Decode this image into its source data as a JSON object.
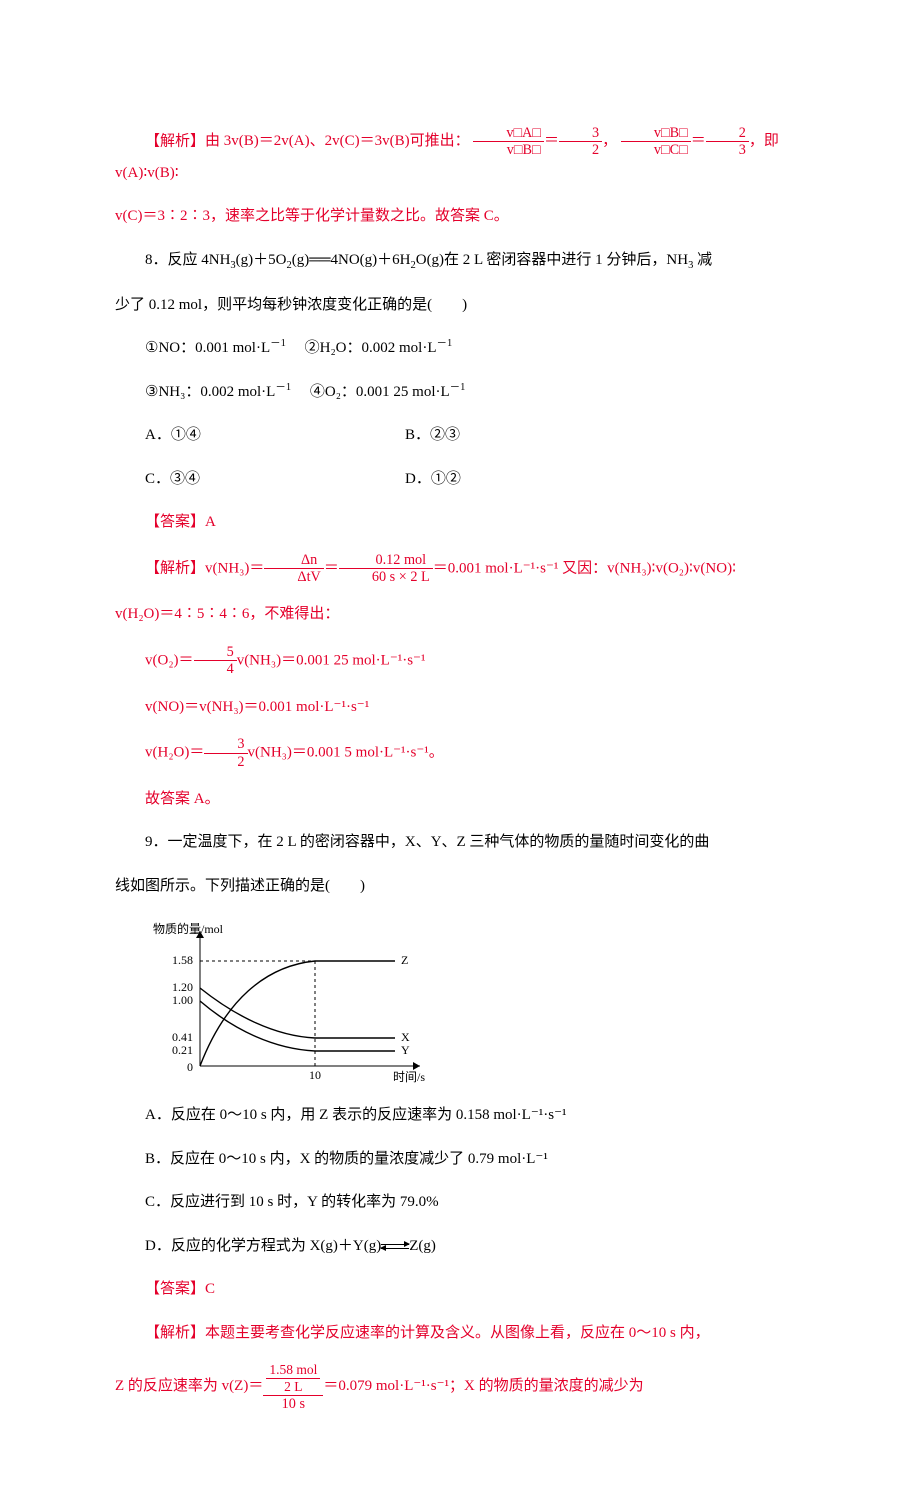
{
  "q7": {
    "analysis_prefix": "【解析】",
    "analysis_body1": "由 3v(B)＝2v(A)、2v(C)＝3v(B)可推出：",
    "frac1_num": "v□A□",
    "frac1_den": "v□B□",
    "frac1_eq": "＝",
    "frac1b_num": "3",
    "frac1b_den": "2",
    "sep1": "，",
    "frac2_num": "v□B□",
    "frac2_den": "v□C□",
    "frac2_eq": "＝",
    "frac2b_num": "2",
    "frac2b_den": "3",
    "tail1": "，即 v(A)∶v(B)∶",
    "line2": "v(C)＝3∶2∶3，速率之比等于化学计量数之比。故答案 C。"
  },
  "q8": {
    "stem_a": "8．反应 4NH",
    "stem_a_sub": "3",
    "stem_b": "(g)＋5O",
    "stem_b_sub": "2",
    "stem_c": "(g)══4NO(g)＋6H",
    "stem_c_sub": "2",
    "stem_d": "O(g)在 2 L 密闭容器中进行 1 分钟后，NH",
    "stem_d_sub": "3",
    "stem_e": " 减",
    "stem_line2": "少了 0.12 mol，则平均每秒钟浓度变化正确的是(　　)",
    "opt1": "①NO：0.001 mol·L",
    "opt1_sup": "－1",
    "opt2": "②H₂O：0.002 mol·L",
    "opt2_sup": "－1",
    "opt3": "③NH₃：0.002 mol·L",
    "opt3_sup": "－1",
    "opt4": "④O₂：0.001 25 mol·L",
    "opt4_sup": "－1",
    "choiceA": "A．①④",
    "choiceB": "B．②③",
    "choiceC": "C．③④",
    "choiceD": "D．①②",
    "answer_label": "【答案】",
    "answer": "A",
    "analysis_label": "【解析】",
    "ana_p1": "v(NH₃)＝",
    "ana_frac1_num": "Δn",
    "ana_frac1_den": "ΔtV",
    "ana_eq1": "＝",
    "ana_frac2_num": "0.12 mol",
    "ana_frac2_den": "60 s × 2 L",
    "ana_p2": "＝0.001 mol·L⁻¹·s⁻¹ 又因：v(NH₃)∶v(O₂)∶v(NO)∶",
    "ana_line2": "v(H₂O)＝4∶5∶4∶6，不难得出：",
    "calc1_a": "v(O₂)＝",
    "calc1_num": "5",
    "calc1_den": "4",
    "calc1_b": "v(NH₃)＝0.001 25 mol·L⁻¹·s⁻¹",
    "calc2": "v(NO)＝v(NH₃)＝0.001 mol·L⁻¹·s⁻¹",
    "calc3_a": "v(H₂O)＝",
    "calc3_num": "3",
    "calc3_den": "2",
    "calc3_b": "v(NH₃)＝0.001 5 mol·L⁻¹·s⁻¹。",
    "ana_end": "故答案 A。"
  },
  "q9": {
    "stem1": "9．一定温度下，在 2 L 的密闭容器中，X、Y、Z 三种气体的物质的量随时间变化的曲",
    "stem2": "线如图所示。下列描述正确的是(　　)",
    "optA": "A．反应在 0～10 s 内，用 Z 表示的反应速率为 0.158 mol·L⁻¹·s⁻¹",
    "optB": "B．反应在 0～10 s 内，X 的物质的量浓度减少了 0.79 mol·L⁻¹",
    "optC": "C．反应进行到 10 s 时，Y 的转化率为 79.0%",
    "optD_a": "D．反应的化学方程式为 X(g)＋Y(g)",
    "optD_b": "Z(g)",
    "answer_label": "【答案】",
    "answer": "C",
    "analysis_label": "【解析】",
    "ana1": "本题主要考查化学反应速率的计算及含义。从图像上看，反应在 0～10 s 内，",
    "ana2_a": "Z 的反应速率为 v(Z)＝",
    "ana2_num_top": "1.58 mol",
    "ana2_num_bot": "2 L",
    "ana2_den": "10 s",
    "ana2_b": "＝0.079 mol·L⁻¹·s⁻¹；X 的物质的量浓度的减少为"
  },
  "chart_data": {
    "type": "line",
    "xlabel": "时间/s",
    "ylabel": "物质的量/mol",
    "x_ticks": [
      0,
      10
    ],
    "y_ticks": [
      0,
      0.21,
      0.41,
      1.0,
      1.2,
      1.58
    ],
    "series": [
      {
        "name": "Z",
        "points": [
          [
            0,
            0
          ],
          [
            10,
            1.58
          ]
        ],
        "final": 1.58
      },
      {
        "name": "X",
        "points": [
          [
            0,
            1.2
          ],
          [
            10,
            0.41
          ]
        ],
        "final": 0.41
      },
      {
        "name": "Y",
        "points": [
          [
            0,
            1.0
          ],
          [
            10,
            0.21
          ]
        ],
        "final": 0.21
      }
    ],
    "xlim": [
      0,
      15
    ],
    "ylim": [
      0,
      1.8
    ]
  }
}
